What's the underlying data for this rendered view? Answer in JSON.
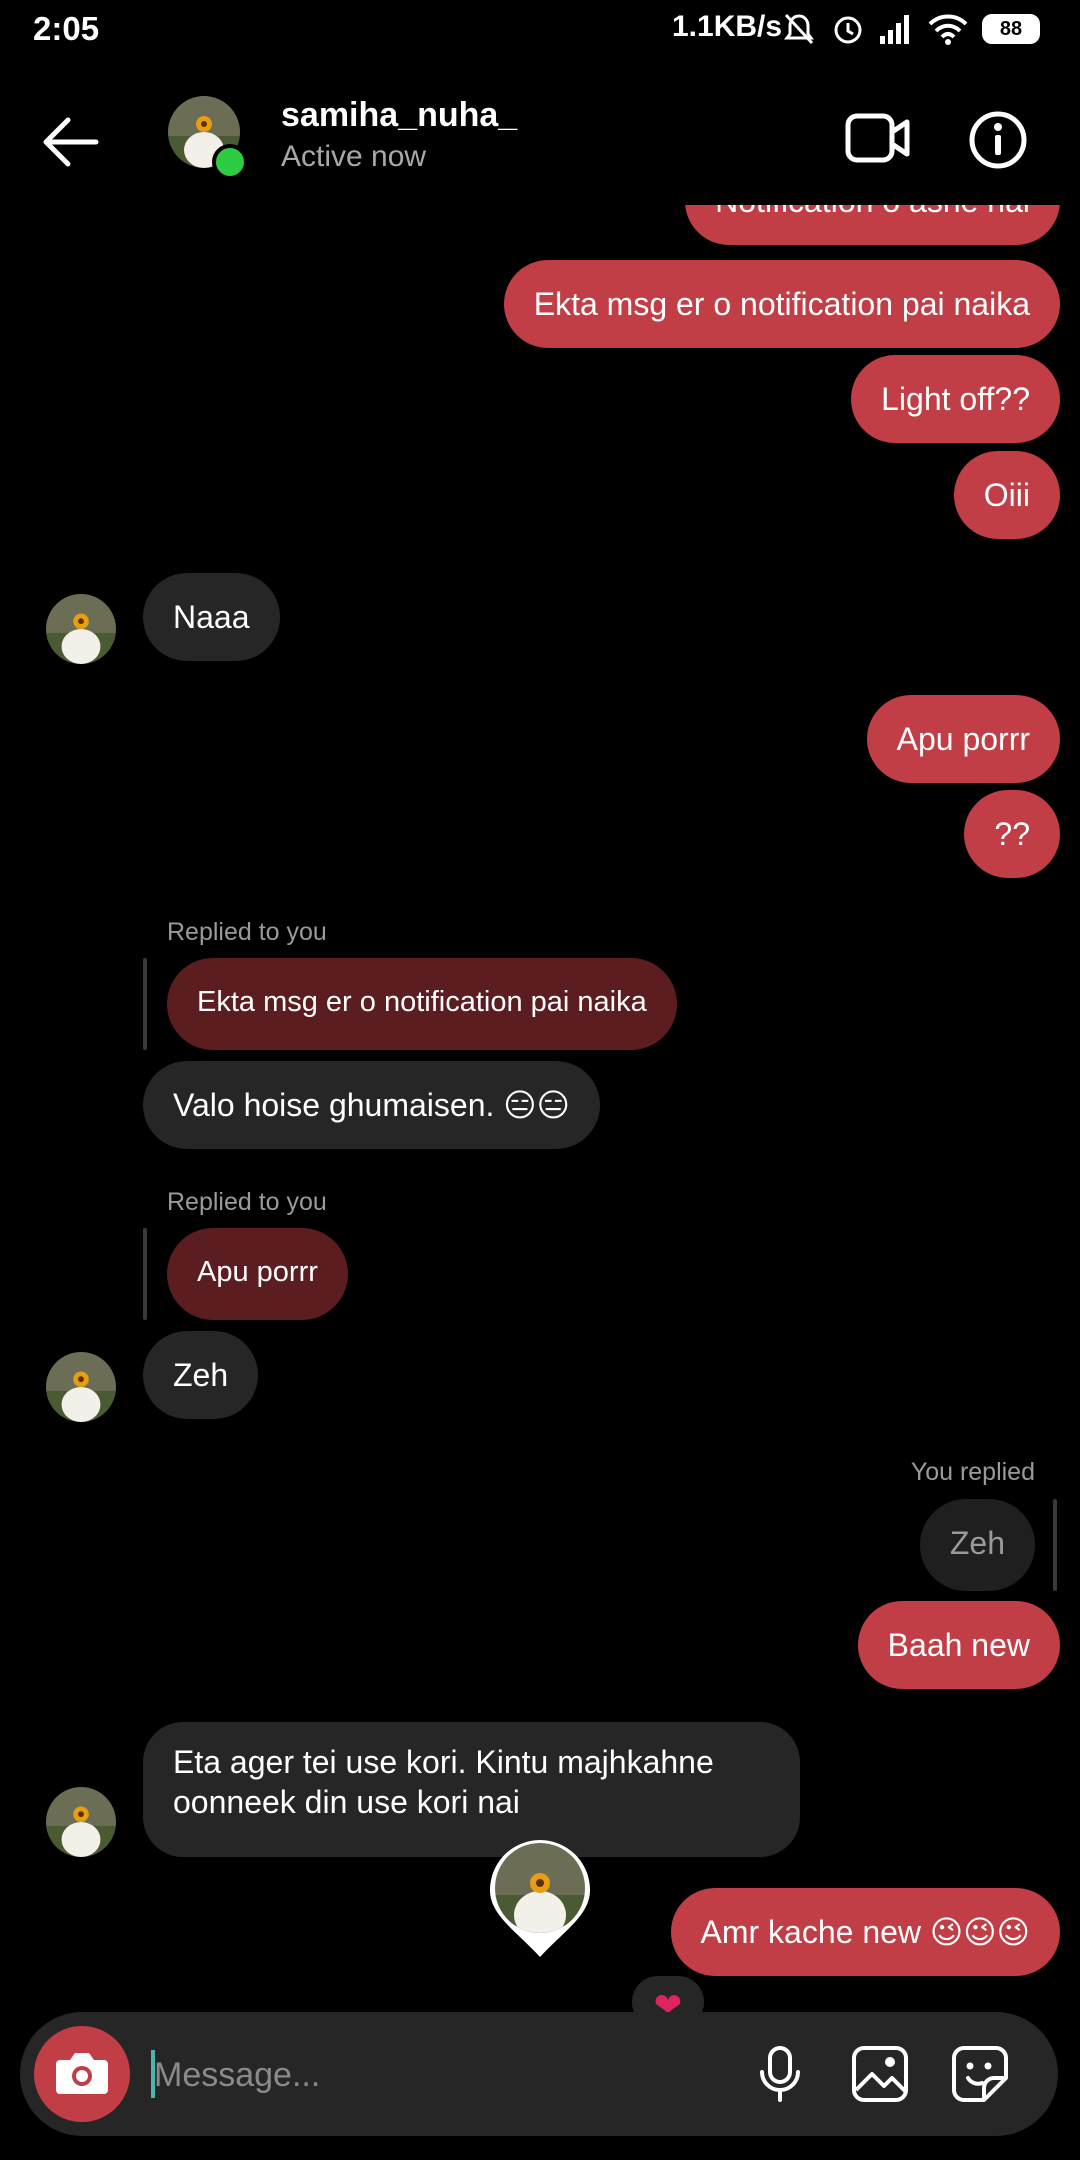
{
  "status_bar": {
    "time": "2:05",
    "speed": "1.1KB/s",
    "battery": "88",
    "icons": [
      "mute-icon",
      "alarm-icon",
      "signal-icon",
      "wifi-icon",
      "battery-icon"
    ]
  },
  "header": {
    "username": "samiha_nuha_",
    "status": "Active now",
    "icons": [
      "back-arrow-icon",
      "video-call-icon",
      "info-icon"
    ]
  },
  "messages": {
    "m0": "Notification o ashe nai",
    "m1": "Ekta msg er o notification pai naika",
    "m2": "Light off??",
    "m3": "Oiii",
    "m4": "Naaa",
    "m5": "Apu porrr",
    "m6": "??",
    "r1_label": "Replied to you",
    "r1_quote": "Ekta msg er o notification pai naika",
    "m7": "Valo hoise ghumaisen. 😑😑",
    "r2_label": "Replied to you",
    "r2_quote": "Apu porrr",
    "m8": "Zeh",
    "r3_label": "You replied",
    "r3_quote": "Zeh",
    "m9": "Baah new",
    "m10_line1": "Eta ager tei use kori. Kintu majhkahne",
    "m10_line2": "oonneek din use kori nai",
    "m11": "Amr kache new 😉😉😉",
    "reaction": "❤"
  },
  "composer": {
    "placeholder": "Message...",
    "icons": [
      "camera-icon",
      "microphone-icon",
      "gallery-icon",
      "sticker-icon"
    ]
  },
  "colors": {
    "outgoing": "#c13e46",
    "incoming": "#262626",
    "online": "#2ecc40"
  }
}
